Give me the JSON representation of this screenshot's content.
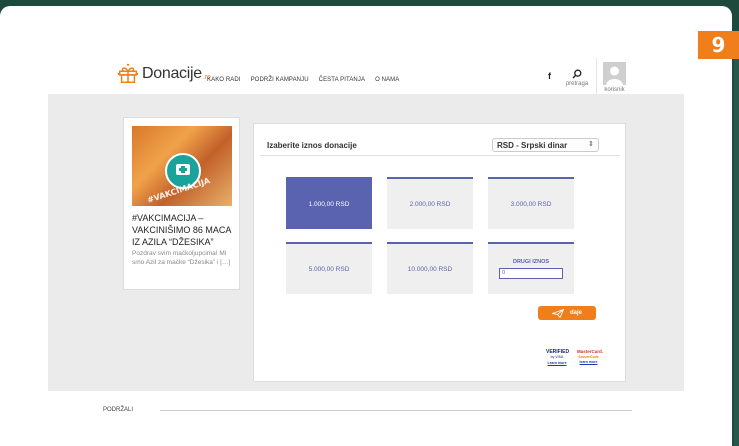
{
  "step_badge": "9",
  "header": {
    "logo_text": "Donacije",
    "logo_tld": ".rs",
    "nav": [
      "KAKO RADI",
      "PODRŽI KAMPANJU",
      "ČESTA PITANJA",
      "O NAMA"
    ],
    "facebook": "f",
    "search_label": "pretraga",
    "user_label": "korisnik"
  },
  "campaign": {
    "image_tag": "#VAKCIMACIJA",
    "title": "#VAKCIMACIJA – VAKCINIŠIMO 86 MACA IZ AZILA “DŽESIKA”",
    "description": "Pozdrav svim mačkoljupcima! Mi smo Azil za mačke “Džesika” i […]"
  },
  "donation": {
    "title": "Izaberite iznos donacije",
    "currency": "RSD - Srpski dinar",
    "amounts": [
      "1.000,00 RSD",
      "2.000,00 RSD",
      "3.000,00 RSD",
      "5.000,00 RSD",
      "10.000,00 RSD"
    ],
    "selected_index": 0,
    "other_label": "DRUGI IZNOS",
    "other_value": "0",
    "submit_label": "daje"
  },
  "payment": {
    "verified_line1": "VERIFIED",
    "verified_line2": "by VISA",
    "verified_learn": "Learn more",
    "mc_line1": "MasterCard.",
    "mc_line2": "SecureCode",
    "mc_learn": "learn more"
  },
  "footer": {
    "label": "PODRŽALI"
  },
  "colors": {
    "accent": "#f07e1a",
    "primary": "#5a63b0",
    "backdrop": "#1e4a3e"
  }
}
